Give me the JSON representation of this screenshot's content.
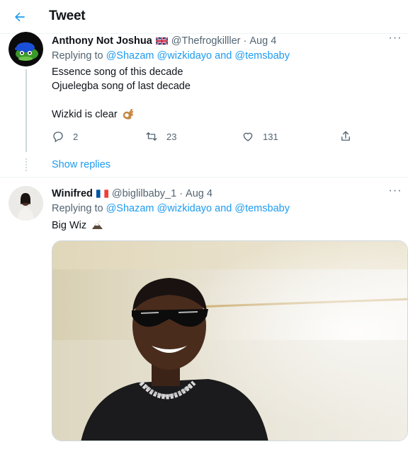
{
  "header": {
    "title": "Tweet",
    "back_icon": "arrow-left-icon"
  },
  "tweets": [
    {
      "name": "Anthony Not Joshua",
      "flag": "flag-uk-icon",
      "handle": "@Thefrogkilller",
      "separator": "·",
      "date": "Aug 4",
      "replying_prefix": "Replying to",
      "mention1": "@Shazam",
      "mention2": "@wizkidayo",
      "and": "and",
      "mention3": "@temsbaby",
      "lines": [
        "Essence song of this decade",
        "Ojuelegba song of last decade",
        "Wizkid is clear"
      ],
      "emoji": "ok-hand-emoji",
      "stats": {
        "replies": "2",
        "retweets": "23",
        "likes": "131"
      },
      "show_replies": "Show replies"
    },
    {
      "name": "Winifred",
      "flag": "flag-france-icon",
      "handle": "@biglilbaby_1",
      "separator": "·",
      "date": "Aug 4",
      "replying_prefix": "Replying to",
      "mention1": "@Shazam",
      "mention2": "@wizkidayo",
      "and": "and",
      "mention3": "@temsbaby",
      "text": "Big Wiz",
      "emoji": "eagle-emoji",
      "media": "photo-man-with-sunglasses-and-chain"
    }
  ],
  "colors": {
    "accent": "#1d9bf0",
    "text": "#0f1419",
    "muted": "#536471",
    "border": "#eff3f4"
  }
}
